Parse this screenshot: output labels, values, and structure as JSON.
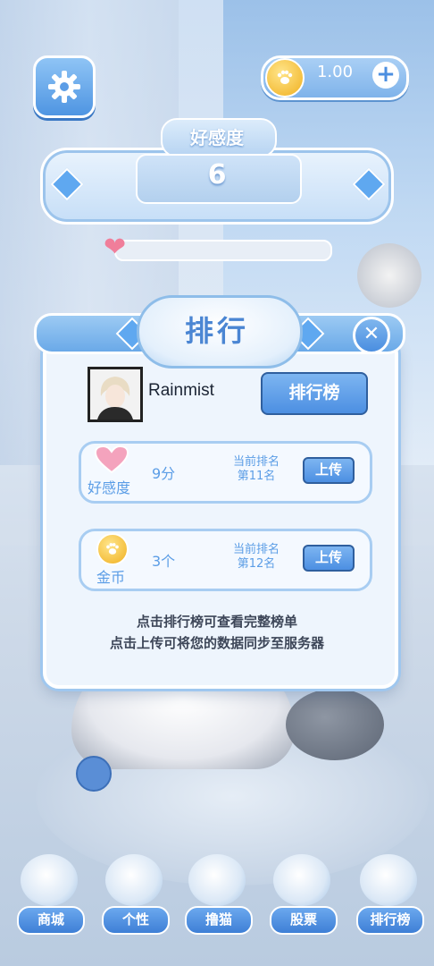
{
  "top_bar": {
    "coin_amount": "1.00",
    "plus_label": "+"
  },
  "favorability": {
    "title": "好感度",
    "value": "6"
  },
  "modal": {
    "title": "排行",
    "close_label": "✕",
    "username": "Rainmist",
    "leaderboard_button": "排行榜",
    "rows": [
      {
        "label": "好感度",
        "value": "9分",
        "rank_line1": "当前排名",
        "rank_line2": "第11名",
        "upload": "上传",
        "icon": "heart-icon"
      },
      {
        "label": "金币",
        "value": "3个",
        "rank_line1": "当前排名",
        "rank_line2": "第12名",
        "upload": "上传",
        "icon": "paw-coin-icon"
      }
    ],
    "hint_line1": "点击排行榜可查看完整榜单",
    "hint_line2": "点击上传可将您的数据同步至服务器"
  },
  "nav": [
    {
      "label": "商城",
      "icon": "shop-icon"
    },
    {
      "label": "个性",
      "icon": "outfit-icon"
    },
    {
      "label": "撸猫",
      "icon": "cat-icon"
    },
    {
      "label": "股票",
      "icon": "stock-chart-icon"
    },
    {
      "label": "排行榜",
      "icon": "trophy-icon"
    }
  ],
  "colors": {
    "accent": "#4c8fe2",
    "heart": "#f07e9a",
    "coin": "#f0b020"
  }
}
